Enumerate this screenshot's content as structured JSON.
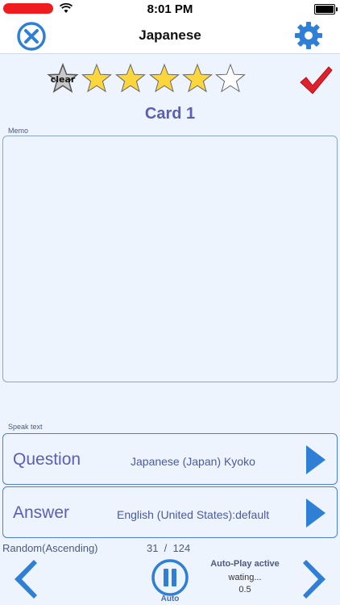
{
  "status_bar": {
    "time": "8:01 PM"
  },
  "nav": {
    "title": "Japanese"
  },
  "rating": {
    "clear_label": "clear",
    "stars_filled": 4,
    "stars_total": 5
  },
  "card": {
    "title": "Card 1"
  },
  "memo": {
    "label": "Memo",
    "text": ""
  },
  "speak": {
    "label": "Speak text",
    "question": {
      "label": "Question",
      "voice": "Japanese (Japan) Kyoko"
    },
    "answer": {
      "label": "Answer",
      "voice": "English (United States):default"
    }
  },
  "footer": {
    "order": "Random(Ascending)",
    "position": "31  /  124",
    "auto_label": "Auto",
    "autoplay_title": "Auto-Play active",
    "autoplay_status": "wating...",
    "autoplay_interval": "0.5"
  },
  "colors": {
    "accent": "#2f7fd6",
    "star_fill": "#fcd63c",
    "check": "#e0202a",
    "title": "#5a5fb5"
  }
}
